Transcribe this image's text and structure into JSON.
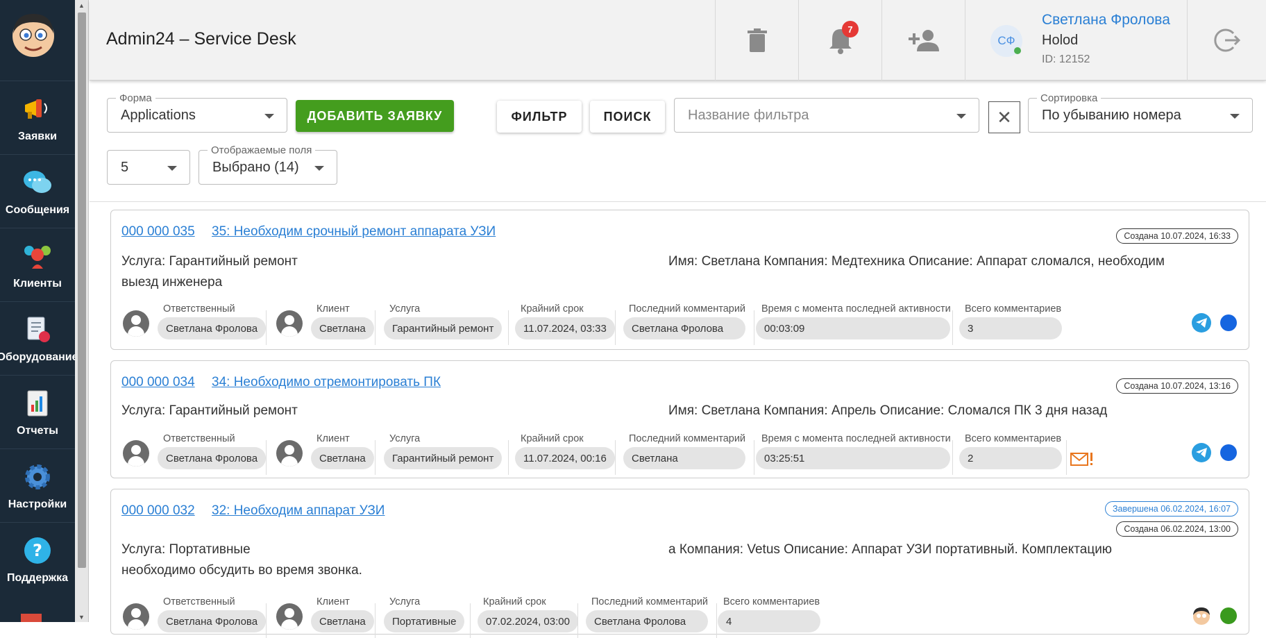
{
  "sidebar": {
    "items": [
      {
        "label": "Заявки",
        "icon": "megaphone-icon"
      },
      {
        "label": "Сообщения",
        "icon": "chat-bubbles-icon"
      },
      {
        "label": "Клиенты",
        "icon": "people-icon"
      },
      {
        "label": "Оборудование",
        "icon": "equipment-checklist-icon"
      },
      {
        "label": "Отчеты",
        "icon": "report-chart-icon"
      },
      {
        "label": "Настройки",
        "icon": "gear-icon"
      },
      {
        "label": "Поддержка",
        "icon": "help-question-icon"
      }
    ]
  },
  "header": {
    "title": "Admin24 – Service Desk",
    "notifications_count": "7",
    "user": {
      "initials": "СФ",
      "name": "Светлана Фролова",
      "org": "Holod",
      "id": "ID: 12152"
    }
  },
  "filters": {
    "form_label": "Форма",
    "form_value": "Applications",
    "add_button": "ДОБАВИТЬ ЗАЯВКУ",
    "filter_button": "ФИЛЬТР",
    "search_button": "ПОИСК",
    "filter_name_placeholder": "Название фильтра",
    "sort_label": "Сортировка",
    "sort_value": "По убыванию номера",
    "page_size": "5",
    "fields_label": "Отображаемые поля",
    "fields_value": "Выбрано (14)"
  },
  "meta_labels": {
    "responsible": "Ответственный",
    "client": "Клиент",
    "service": "Услуга",
    "deadline": "Крайний срок",
    "last_comment": "Последний комментарий",
    "time_since": "Время с момента последней активности",
    "total_comments": "Всего комментариев"
  },
  "tickets": [
    {
      "number": "000 000 035",
      "title": "35: Необходим срочный ремонт аппарата УЗИ",
      "created": "Создана 10.07.2024, 16:33",
      "service_line": "Услуга: Гарантийный ремонт",
      "info_line": "Имя: Светлана Компания: Медтехника Описание: Аппарат сломался, необходим",
      "info_line2": "выезд инженера",
      "responsible": "Светлана Фролова",
      "client": "Светлана",
      "service": "Гарантийный ремонт",
      "deadline": "11.07.2024, 03:33",
      "last_comment": "Светлана Фролова",
      "time_since": "00:03:09",
      "total_comments": "3",
      "status_color": "#1565e0"
    },
    {
      "number": "000 000 034",
      "title": "34: Необходимо отремонтировать ПК",
      "created": "Создана 10.07.2024, 13:16",
      "service_line": "Услуга: Гарантийный ремонт",
      "info_line": "Имя: Светлана Компания: Апрель Описание: Сломался ПК 3 дня назад",
      "responsible": "Светлана Фролова",
      "client": "Светлана",
      "service": "Гарантийный ремонт",
      "deadline": "11.07.2024, 00:16",
      "last_comment": "Светлана",
      "time_since": "03:25:51",
      "total_comments": "2",
      "status_color": "#1565e0"
    },
    {
      "number": "000 000 032",
      "title": "32: Необходим аппарат УЗИ",
      "completed": "Завершена 06.02.2024, 16:07",
      "created": "Создана 06.02.2024, 13:00",
      "service_line": "Услуга: Портативные",
      "info_line": "а Компания: Vetus Описание: Аппарат УЗИ портативный. Комплектацию",
      "info_line2": "необходимо обсудить во время звонка.",
      "responsible": "Светлана Фролова",
      "client": "Светлана",
      "service": "Портативные",
      "deadline": "07.02.2024, 03:00",
      "last_comment": "Светлана Фролова",
      "total_comments": "4",
      "status_color": "#3a9a1e"
    }
  ]
}
